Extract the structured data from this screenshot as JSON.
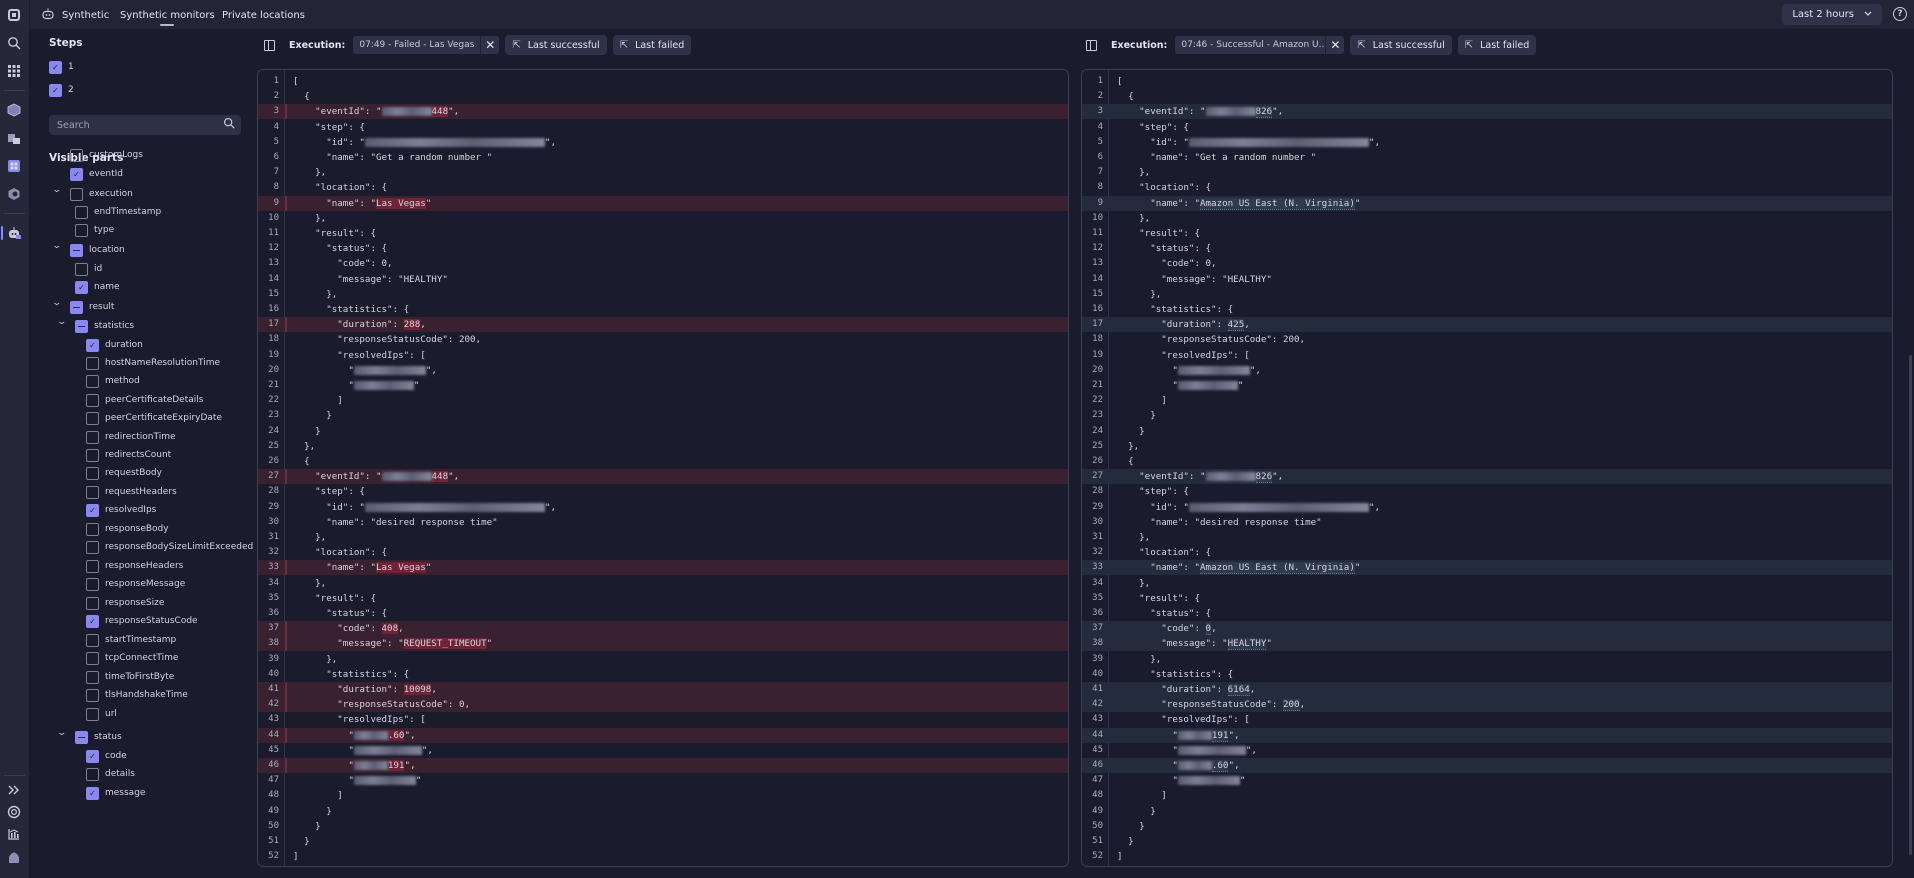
{
  "topbar": {
    "app_name": "Synthetic",
    "nav": [
      "Synthetic monitors",
      "Private locations"
    ],
    "active_nav": "Synthetic monitors",
    "timeframe": "Last 2 hours",
    "help_glyph": "?"
  },
  "rail": {
    "icons": [
      "dynatrace-logo-icon",
      "search-icon",
      "apps-grid-icon",
      "cube-icon",
      "workflow-icon",
      "dashboard-icon",
      "hexagon-icon",
      "synthetic-robot-icon",
      "expand-icon",
      "support-icon",
      "chart-icon",
      "user-avatar-icon"
    ]
  },
  "sidebar": {
    "steps_title": "Steps",
    "steps": [
      {
        "label": "1",
        "checked": true
      },
      {
        "label": "2",
        "checked": true
      }
    ],
    "search_placeholder": "Search",
    "visible_parts_title": "Visible parts",
    "tree": [
      {
        "label": "customLogs",
        "state": "off",
        "level": 0,
        "expandable": false
      },
      {
        "label": "eventId",
        "state": "on",
        "level": 0,
        "expandable": false
      },
      {
        "label": "execution",
        "state": "off",
        "level": 0,
        "expandable": true
      },
      {
        "label": "endTimestamp",
        "state": "off",
        "level": 1
      },
      {
        "label": "type",
        "state": "off",
        "level": 1
      },
      {
        "label": "location",
        "state": "partial",
        "level": 0,
        "expandable": true
      },
      {
        "label": "id",
        "state": "off",
        "level": 1
      },
      {
        "label": "name",
        "state": "on",
        "level": 1
      },
      {
        "label": "result",
        "state": "partial",
        "level": 0,
        "expandable": true
      },
      {
        "label": "statistics",
        "state": "partial",
        "level": 1,
        "expandable": true
      },
      {
        "label": "duration",
        "state": "on",
        "level": 2
      },
      {
        "label": "hostNameResolutionTime",
        "state": "off",
        "level": 2
      },
      {
        "label": "method",
        "state": "off",
        "level": 2
      },
      {
        "label": "peerCertificateDetails",
        "state": "off",
        "level": 2
      },
      {
        "label": "peerCertificateExpiryDate",
        "state": "off",
        "level": 2
      },
      {
        "label": "redirectionTime",
        "state": "off",
        "level": 2
      },
      {
        "label": "redirectsCount",
        "state": "off",
        "level": 2
      },
      {
        "label": "requestBody",
        "state": "off",
        "level": 2
      },
      {
        "label": "requestHeaders",
        "state": "off",
        "level": 2
      },
      {
        "label": "resolvedIps",
        "state": "on",
        "level": 2
      },
      {
        "label": "responseBody",
        "state": "off",
        "level": 2
      },
      {
        "label": "responseBodySizeLimitExceeded",
        "state": "off",
        "level": 2
      },
      {
        "label": "responseHeaders",
        "state": "off",
        "level": 2
      },
      {
        "label": "responseMessage",
        "state": "off",
        "level": 2
      },
      {
        "label": "responseSize",
        "state": "off",
        "level": 2
      },
      {
        "label": "responseStatusCode",
        "state": "on",
        "level": 2
      },
      {
        "label": "startTimestamp",
        "state": "off",
        "level": 2
      },
      {
        "label": "tcpConnectTime",
        "state": "off",
        "level": 2
      },
      {
        "label": "timeToFirstByte",
        "state": "off",
        "level": 2
      },
      {
        "label": "tlsHandshakeTime",
        "state": "off",
        "level": 2
      },
      {
        "label": "url",
        "state": "off",
        "level": 2
      },
      {
        "label": "status",
        "state": "partial",
        "level": 1,
        "expandable": true
      },
      {
        "label": "code",
        "state": "on",
        "level": 2
      },
      {
        "label": "details",
        "state": "off",
        "level": 2
      },
      {
        "label": "message",
        "state": "on",
        "level": 2
      }
    ]
  },
  "panels": [
    {
      "execution_label": "Execution:",
      "execution_value": "07:49 - Failed - Las Vegas",
      "last_successful_label": "Last successful",
      "last_failed_label": "Last failed",
      "diff_style": "failed",
      "lines": [
        {
          "t": "["
        },
        {
          "t": "  {"
        },
        {
          "t": "    \"eventId\": \"",
          "blur": 50,
          "hl": "448",
          "after": "\",",
          "diff": true
        },
        {
          "t": "    \"step\": {"
        },
        {
          "t": "      \"id\": \"",
          "blur": 180,
          "after": "\","
        },
        {
          "t": "      \"name\": \"Get a random number \""
        },
        {
          "t": "    },"
        },
        {
          "t": "    \"location\": {"
        },
        {
          "t": "      \"name\": \"",
          "hl": "Las Vegas",
          "after": "\"",
          "diff": true
        },
        {
          "t": "    },"
        },
        {
          "t": "    \"result\": {"
        },
        {
          "t": "      \"status\": {"
        },
        {
          "t": "        \"code\": 0,"
        },
        {
          "t": "        \"message\": \"HEALTHY\""
        },
        {
          "t": "      },"
        },
        {
          "t": "      \"statistics\": {"
        },
        {
          "t": "        \"duration\": ",
          "hl": "288",
          "after": ",",
          "diff": true
        },
        {
          "t": "        \"responseStatusCode\": 200,"
        },
        {
          "t": "        \"resolvedIps\": ["
        },
        {
          "t": "          \"",
          "blur": 72,
          "after": "\","
        },
        {
          "t": "          \"",
          "blur": 60,
          "after": "\""
        },
        {
          "t": "        ]"
        },
        {
          "t": "      }"
        },
        {
          "t": "    }"
        },
        {
          "t": "  },"
        },
        {
          "t": "  {"
        },
        {
          "t": "    \"eventId\": \"",
          "blur": 50,
          "hl": "448",
          "after": "\",",
          "diff": true
        },
        {
          "t": "    \"step\": {"
        },
        {
          "t": "      \"id\": \"",
          "blur": 180,
          "after": "\","
        },
        {
          "t": "      \"name\": \"desired response time\""
        },
        {
          "t": "    },"
        },
        {
          "t": "    \"location\": {"
        },
        {
          "t": "      \"name\": \"",
          "hl": "Las Vegas",
          "after": "\"",
          "diff": true
        },
        {
          "t": "    },"
        },
        {
          "t": "    \"result\": {"
        },
        {
          "t": "      \"status\": {"
        },
        {
          "t": "        \"code\": ",
          "hl": "408",
          "after": ",",
          "diff": true
        },
        {
          "t": "        \"message\": \"",
          "hl": "REQUEST_TIMEOUT",
          "after": "\"",
          "diff": true
        },
        {
          "t": "      },"
        },
        {
          "t": "      \"statistics\": {"
        },
        {
          "t": "        \"duration\": ",
          "hl": "10098",
          "after": ",",
          "diff": true
        },
        {
          "t": "        \"responseStatusCode\": 0,",
          "diff": true
        },
        {
          "t": "        \"resolvedIps\": ["
        },
        {
          "t": "          \"",
          "blur": 34,
          "hl": ".60",
          "after": "\",",
          "diff": true
        },
        {
          "t": "          \"",
          "blur": 68,
          "after": "\","
        },
        {
          "t": "          \"",
          "blur": 34,
          "hl": "191",
          "after": "\",",
          "diff": true
        },
        {
          "t": "          \"",
          "blur": 62,
          "after": "\""
        },
        {
          "t": "        ]"
        },
        {
          "t": "      }"
        },
        {
          "t": "    }"
        },
        {
          "t": "  }"
        },
        {
          "t": "]"
        }
      ]
    },
    {
      "execution_label": "Execution:",
      "execution_value": "07:46 - Successful - Amazon U...",
      "last_successful_label": "Last successful",
      "last_failed_label": "Last failed",
      "diff_style": "successful",
      "lines": [
        {
          "t": "["
        },
        {
          "t": "  {"
        },
        {
          "t": "    \"eventId\": \"",
          "blur": 50,
          "hl": "826",
          "after": "\",",
          "diff": true
        },
        {
          "t": "    \"step\": {"
        },
        {
          "t": "      \"id\": \"",
          "blur": 180,
          "after": "\","
        },
        {
          "t": "      \"name\": \"Get a random number \""
        },
        {
          "t": "    },"
        },
        {
          "t": "    \"location\": {"
        },
        {
          "t": "      \"name\": \"",
          "hl": "Amazon US East (N. Virginia)",
          "after": "\"",
          "diff": true
        },
        {
          "t": "    },"
        },
        {
          "t": "    \"result\": {"
        },
        {
          "t": "      \"status\": {"
        },
        {
          "t": "        \"code\": 0,"
        },
        {
          "t": "        \"message\": \"HEALTHY\""
        },
        {
          "t": "      },"
        },
        {
          "t": "      \"statistics\": {"
        },
        {
          "t": "        \"duration\": ",
          "hl": "425",
          "after": ",",
          "diff": true
        },
        {
          "t": "        \"responseStatusCode\": 200,"
        },
        {
          "t": "        \"resolvedIps\": ["
        },
        {
          "t": "          \"",
          "blur": 72,
          "after": "\","
        },
        {
          "t": "          \"",
          "blur": 60,
          "after": "\""
        },
        {
          "t": "        ]"
        },
        {
          "t": "      }"
        },
        {
          "t": "    }"
        },
        {
          "t": "  },"
        },
        {
          "t": "  {"
        },
        {
          "t": "    \"eventId\": \"",
          "blur": 50,
          "hl": "826",
          "after": "\",",
          "diff": true
        },
        {
          "t": "    \"step\": {"
        },
        {
          "t": "      \"id\": \"",
          "blur": 180,
          "after": "\","
        },
        {
          "t": "      \"name\": \"desired response time\""
        },
        {
          "t": "    },"
        },
        {
          "t": "    \"location\": {"
        },
        {
          "t": "      \"name\": \"",
          "hl": "Amazon US East (N. Virginia)",
          "after": "\"",
          "diff": true
        },
        {
          "t": "    },"
        },
        {
          "t": "    \"result\": {"
        },
        {
          "t": "      \"status\": {"
        },
        {
          "t": "        \"code\": ",
          "hl": "0",
          "after": ",",
          "diff": true
        },
        {
          "t": "        \"message\": \"",
          "hl": "HEALTHY",
          "after": "\"",
          "diff": true
        },
        {
          "t": "      },"
        },
        {
          "t": "      \"statistics\": {"
        },
        {
          "t": "        \"duration\": ",
          "hl": "6164",
          "after": ",",
          "diff": true
        },
        {
          "t": "        \"responseStatusCode\": ",
          "hl": "200",
          "after": ",",
          "diff": true
        },
        {
          "t": "        \"resolvedIps\": ["
        },
        {
          "t": "          \"",
          "blur": 34,
          "hl": "191",
          "after": "\",",
          "diff": true
        },
        {
          "t": "          \"",
          "blur": 68,
          "after": "\","
        },
        {
          "t": "          \"",
          "blur": 34,
          "hl": ".60",
          "after": "\",",
          "diff": true
        },
        {
          "t": "          \"",
          "blur": 62,
          "after": "\""
        },
        {
          "t": "        ]"
        },
        {
          "t": "      }"
        },
        {
          "t": "    }"
        },
        {
          "t": "  }"
        },
        {
          "t": "]"
        }
      ]
    }
  ],
  "colors": {
    "accent": "#8a88f0",
    "failed_diff": "#3a2130",
    "failed_highlight": "#6e2436",
    "success_diff": "#232b3c",
    "success_highlight": "#2f3a4d"
  }
}
